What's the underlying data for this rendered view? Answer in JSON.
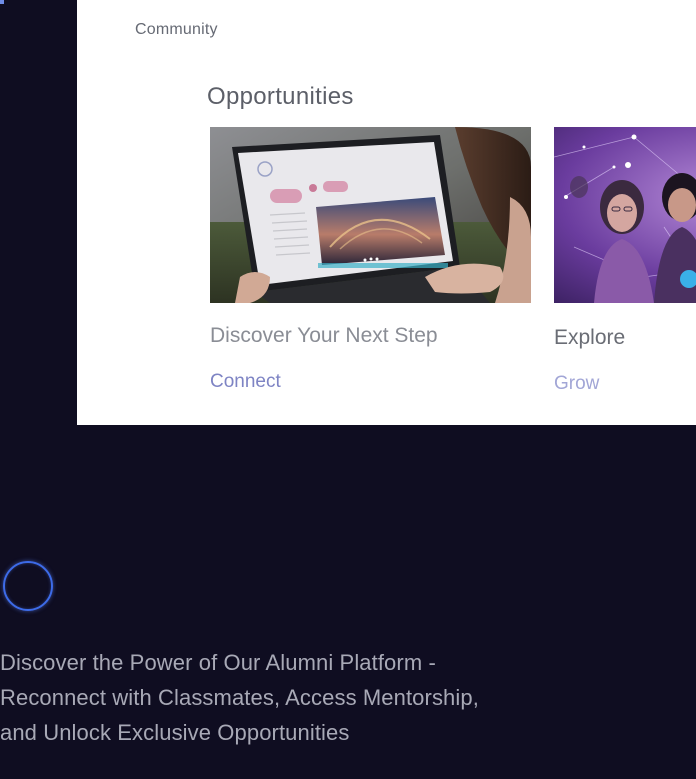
{
  "breadcrumb": "Community",
  "section": {
    "title": "Opportunities"
  },
  "cards": [
    {
      "title": "Discover Your Next Step",
      "link_label": "Connect"
    },
    {
      "title": "Explore",
      "link_label": "Grow"
    }
  ],
  "hero": {
    "tagline": "Discover the Power of Our Alumni Platform - Reconnect with Classmates, Access Mentorship, and Unlock Exclusive Opportunities"
  },
  "colors": {
    "background": "#0f0d21",
    "panel": "#ffffff",
    "link": "#7e84c4",
    "spinner": "#3d6be8"
  }
}
